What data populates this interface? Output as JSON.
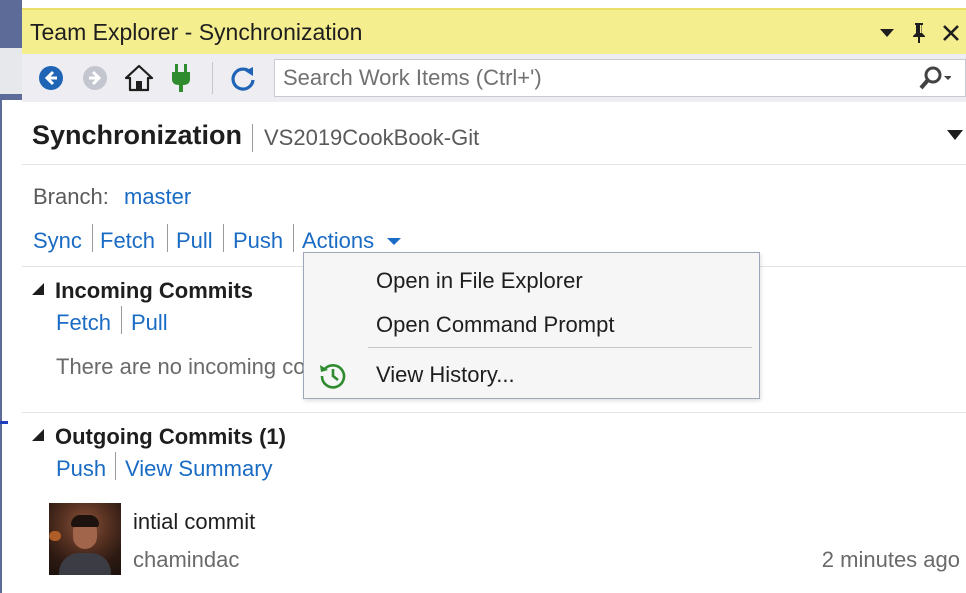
{
  "window": {
    "title": "Team Explorer - Synchronization"
  },
  "toolbar": {
    "icons": [
      "back-arrow-icon",
      "forward-arrow-icon",
      "home-icon",
      "connect-plug-icon",
      "refresh-icon"
    ]
  },
  "search": {
    "placeholder": "Search Work Items (Ctrl+')"
  },
  "header": {
    "title": "Synchronization",
    "repository": "VS2019CookBook-Git"
  },
  "branch": {
    "label": "Branch:",
    "name": "master"
  },
  "actions": {
    "sync": "Sync",
    "fetch": "Fetch",
    "pull": "Pull",
    "push": "Push",
    "actions": "Actions"
  },
  "actions_menu": {
    "items": [
      "Open in File Explorer",
      "Open Command Prompt",
      "View History..."
    ]
  },
  "incoming": {
    "title": "Incoming Commits",
    "fetch": "Fetch",
    "pull": "Pull",
    "empty_text": "There are no incoming commits."
  },
  "outgoing": {
    "title": "Outgoing Commits (1)",
    "push": "Push",
    "view_summary": "View Summary",
    "commits": [
      {
        "message": "intial commit",
        "author": "chamindac",
        "time": "2 minutes ago"
      }
    ]
  },
  "colors": {
    "title_bar": "#f5ee8f",
    "link": "#1a6bc4",
    "toolbar_bg": "#eeeef2"
  }
}
